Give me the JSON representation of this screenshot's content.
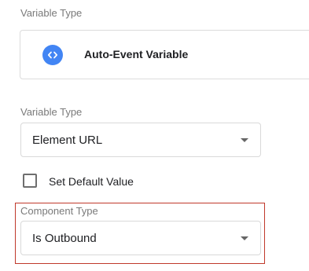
{
  "variable_type_section": {
    "label": "Variable Type",
    "selected_type": "Auto-Event Variable",
    "type_icon": "code-brackets-icon",
    "icon_color": "#4285f4"
  },
  "element_variable_type": {
    "label": "Variable Type",
    "value": "Element URL"
  },
  "default_value": {
    "label": "Set Default Value",
    "checked": false
  },
  "component_type": {
    "label": "Component Type",
    "value": "Is Outbound",
    "highlight_color": "#c0392b"
  }
}
